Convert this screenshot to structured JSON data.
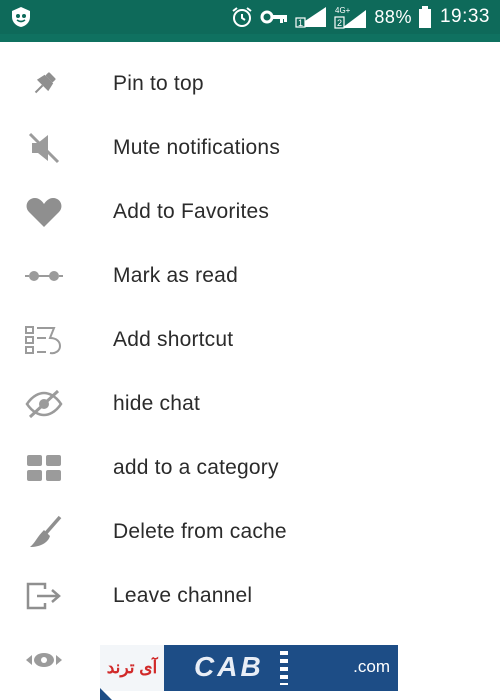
{
  "status_bar": {
    "battery_percent": "88%",
    "time": "19:33",
    "network_badge": "4G+",
    "sim_1": "1",
    "sim_2": "2",
    "icons": [
      "app-logo-icon",
      "alarm-icon",
      "vpn-key-icon",
      "signal-sim1-icon",
      "signal-sim2-4g-icon",
      "battery-icon"
    ]
  },
  "menu": {
    "items": [
      {
        "label": "Pin to top",
        "icon": "pin-icon"
      },
      {
        "label": "Mute notifications",
        "icon": "mute-icon"
      },
      {
        "label": "Add to Favorites",
        "icon": "heart-icon"
      },
      {
        "label": "Mark as read",
        "icon": "glasses-icon"
      },
      {
        "label": "Add shortcut",
        "icon": "shortcut-icon"
      },
      {
        "label": "hide chat",
        "icon": "hidden-eye-icon"
      },
      {
        "label": "add to a category",
        "icon": "category-grid-icon"
      },
      {
        "label": "Delete from cache",
        "icon": "broom-icon"
      },
      {
        "label": "Leave channel",
        "icon": "exit-icon"
      },
      {
        "label": "",
        "icon": "eye-icon"
      }
    ]
  },
  "watermark": {
    "left_text": "آی ترند",
    "main_text": "CAB",
    "suffix": ".com"
  },
  "colors": {
    "status_bar": "#0e6a5a",
    "icon_gray": "#9a9a9a",
    "label_text": "#2b2b2b",
    "watermark_blue": "#1d4d86",
    "watermark_red": "#d12a2a"
  }
}
